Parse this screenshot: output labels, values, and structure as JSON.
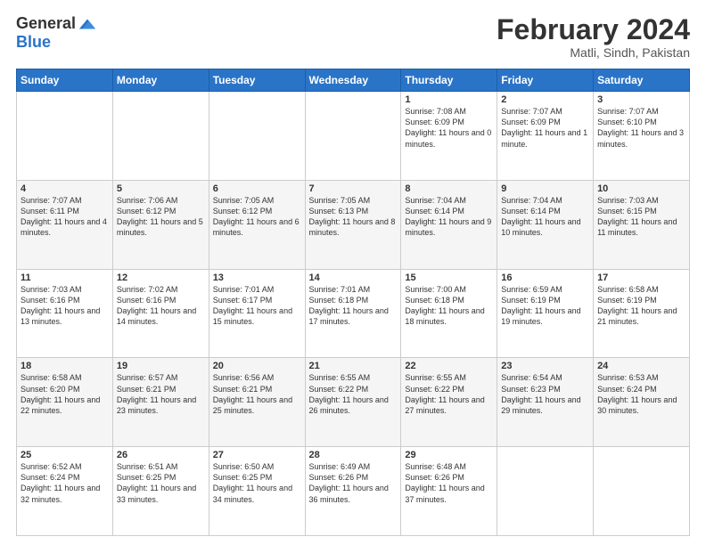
{
  "logo": {
    "text_general": "General",
    "text_blue": "Blue"
  },
  "header": {
    "month_year": "February 2024",
    "location": "Matli, Sindh, Pakistan"
  },
  "weekdays": [
    "Sunday",
    "Monday",
    "Tuesday",
    "Wednesday",
    "Thursday",
    "Friday",
    "Saturday"
  ],
  "weeks": [
    [
      {
        "day": "",
        "info": ""
      },
      {
        "day": "",
        "info": ""
      },
      {
        "day": "",
        "info": ""
      },
      {
        "day": "",
        "info": ""
      },
      {
        "day": "1",
        "info": "Sunrise: 7:08 AM\nSunset: 6:09 PM\nDaylight: 11 hours and 0 minutes."
      },
      {
        "day": "2",
        "info": "Sunrise: 7:07 AM\nSunset: 6:09 PM\nDaylight: 11 hours and 1 minute."
      },
      {
        "day": "3",
        "info": "Sunrise: 7:07 AM\nSunset: 6:10 PM\nDaylight: 11 hours and 3 minutes."
      }
    ],
    [
      {
        "day": "4",
        "info": "Sunrise: 7:07 AM\nSunset: 6:11 PM\nDaylight: 11 hours and 4 minutes."
      },
      {
        "day": "5",
        "info": "Sunrise: 7:06 AM\nSunset: 6:12 PM\nDaylight: 11 hours and 5 minutes."
      },
      {
        "day": "6",
        "info": "Sunrise: 7:05 AM\nSunset: 6:12 PM\nDaylight: 11 hours and 6 minutes."
      },
      {
        "day": "7",
        "info": "Sunrise: 7:05 AM\nSunset: 6:13 PM\nDaylight: 11 hours and 8 minutes."
      },
      {
        "day": "8",
        "info": "Sunrise: 7:04 AM\nSunset: 6:14 PM\nDaylight: 11 hours and 9 minutes."
      },
      {
        "day": "9",
        "info": "Sunrise: 7:04 AM\nSunset: 6:14 PM\nDaylight: 11 hours and 10 minutes."
      },
      {
        "day": "10",
        "info": "Sunrise: 7:03 AM\nSunset: 6:15 PM\nDaylight: 11 hours and 11 minutes."
      }
    ],
    [
      {
        "day": "11",
        "info": "Sunrise: 7:03 AM\nSunset: 6:16 PM\nDaylight: 11 hours and 13 minutes."
      },
      {
        "day": "12",
        "info": "Sunrise: 7:02 AM\nSunset: 6:16 PM\nDaylight: 11 hours and 14 minutes."
      },
      {
        "day": "13",
        "info": "Sunrise: 7:01 AM\nSunset: 6:17 PM\nDaylight: 11 hours and 15 minutes."
      },
      {
        "day": "14",
        "info": "Sunrise: 7:01 AM\nSunset: 6:18 PM\nDaylight: 11 hours and 17 minutes."
      },
      {
        "day": "15",
        "info": "Sunrise: 7:00 AM\nSunset: 6:18 PM\nDaylight: 11 hours and 18 minutes."
      },
      {
        "day": "16",
        "info": "Sunrise: 6:59 AM\nSunset: 6:19 PM\nDaylight: 11 hours and 19 minutes."
      },
      {
        "day": "17",
        "info": "Sunrise: 6:58 AM\nSunset: 6:19 PM\nDaylight: 11 hours and 21 minutes."
      }
    ],
    [
      {
        "day": "18",
        "info": "Sunrise: 6:58 AM\nSunset: 6:20 PM\nDaylight: 11 hours and 22 minutes."
      },
      {
        "day": "19",
        "info": "Sunrise: 6:57 AM\nSunset: 6:21 PM\nDaylight: 11 hours and 23 minutes."
      },
      {
        "day": "20",
        "info": "Sunrise: 6:56 AM\nSunset: 6:21 PM\nDaylight: 11 hours and 25 minutes."
      },
      {
        "day": "21",
        "info": "Sunrise: 6:55 AM\nSunset: 6:22 PM\nDaylight: 11 hours and 26 minutes."
      },
      {
        "day": "22",
        "info": "Sunrise: 6:55 AM\nSunset: 6:22 PM\nDaylight: 11 hours and 27 minutes."
      },
      {
        "day": "23",
        "info": "Sunrise: 6:54 AM\nSunset: 6:23 PM\nDaylight: 11 hours and 29 minutes."
      },
      {
        "day": "24",
        "info": "Sunrise: 6:53 AM\nSunset: 6:24 PM\nDaylight: 11 hours and 30 minutes."
      }
    ],
    [
      {
        "day": "25",
        "info": "Sunrise: 6:52 AM\nSunset: 6:24 PM\nDaylight: 11 hours and 32 minutes."
      },
      {
        "day": "26",
        "info": "Sunrise: 6:51 AM\nSunset: 6:25 PM\nDaylight: 11 hours and 33 minutes."
      },
      {
        "day": "27",
        "info": "Sunrise: 6:50 AM\nSunset: 6:25 PM\nDaylight: 11 hours and 34 minutes."
      },
      {
        "day": "28",
        "info": "Sunrise: 6:49 AM\nSunset: 6:26 PM\nDaylight: 11 hours and 36 minutes."
      },
      {
        "day": "29",
        "info": "Sunrise: 6:48 AM\nSunset: 6:26 PM\nDaylight: 11 hours and 37 minutes."
      },
      {
        "day": "",
        "info": ""
      },
      {
        "day": "",
        "info": ""
      }
    ]
  ]
}
